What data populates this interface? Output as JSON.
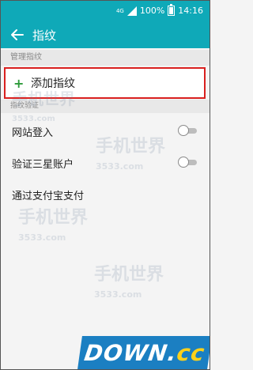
{
  "status": {
    "signal_label": "4G",
    "battery": "100%",
    "time": "14:16"
  },
  "appbar": {
    "title": "指纹"
  },
  "sections": {
    "manage": "管理指纹",
    "verify": "指纹验证"
  },
  "add_fingerprint": {
    "label": "添加指纹"
  },
  "rows": [
    {
      "label": "网站登入",
      "toggle": false
    },
    {
      "label": "验证三星账户",
      "toggle": false
    },
    {
      "label": "通过支付宝支付"
    }
  ],
  "watermark": {
    "text": "手机世界",
    "subtext": "3533.com"
  },
  "banner": {
    "main": "DOWN",
    "dot": ".",
    "suffix": "cc"
  },
  "colors": {
    "accent": "#0fa9b8",
    "highlight_border": "#d9201f",
    "plus": "#2d9a3a"
  }
}
